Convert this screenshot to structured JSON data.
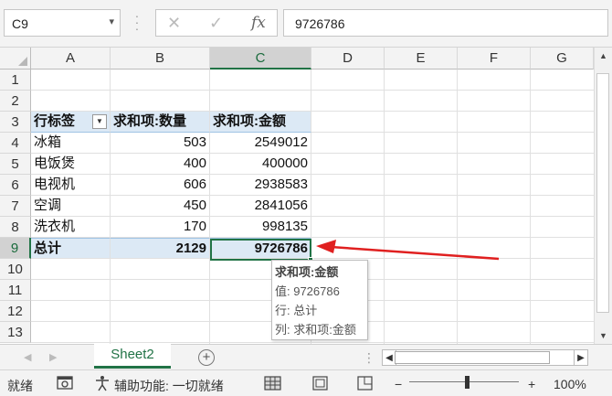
{
  "name_box": "C9",
  "formula_bar": {
    "value": "9726786",
    "fx_label": "fx",
    "cancel_glyph": "✕",
    "enter_glyph": "✓"
  },
  "columns": [
    "A",
    "B",
    "C",
    "D",
    "E",
    "F",
    "G"
  ],
  "selected_column": "C",
  "rows": [
    "1",
    "2",
    "3",
    "4",
    "5",
    "6",
    "7",
    "8",
    "9",
    "10",
    "11",
    "12",
    "13"
  ],
  "selected_row": "9",
  "pivot": {
    "header": {
      "row_label": "行标签",
      "col1": "求和项:数量",
      "col2": "求和项:金额"
    },
    "rows": [
      {
        "label": "冰箱",
        "qty": "503",
        "amount": "2549012"
      },
      {
        "label": "电饭煲",
        "qty": "400",
        "amount": "400000"
      },
      {
        "label": "电视机",
        "qty": "606",
        "amount": "2938583"
      },
      {
        "label": "空调",
        "qty": "450",
        "amount": "2841056"
      },
      {
        "label": "洗衣机",
        "qty": "170",
        "amount": "998135"
      }
    ],
    "total": {
      "label": "总计",
      "qty": "2129",
      "amount": "9726786"
    }
  },
  "tooltip": {
    "title": "求和项:金额",
    "value_line": "值: 9726786",
    "row_line": "行: 总计",
    "col_line": "列: 求和项:金额"
  },
  "sheet_tab": "Sheet2",
  "status": {
    "ready": "就绪",
    "accessibility": "辅助功能: 一切就绪",
    "zoom": "100%",
    "zoom_minus": "−",
    "zoom_plus": "+"
  },
  "colors": {
    "accent": "#217346",
    "pivot_fill": "#dce9f5",
    "arrow": "#e02020"
  }
}
